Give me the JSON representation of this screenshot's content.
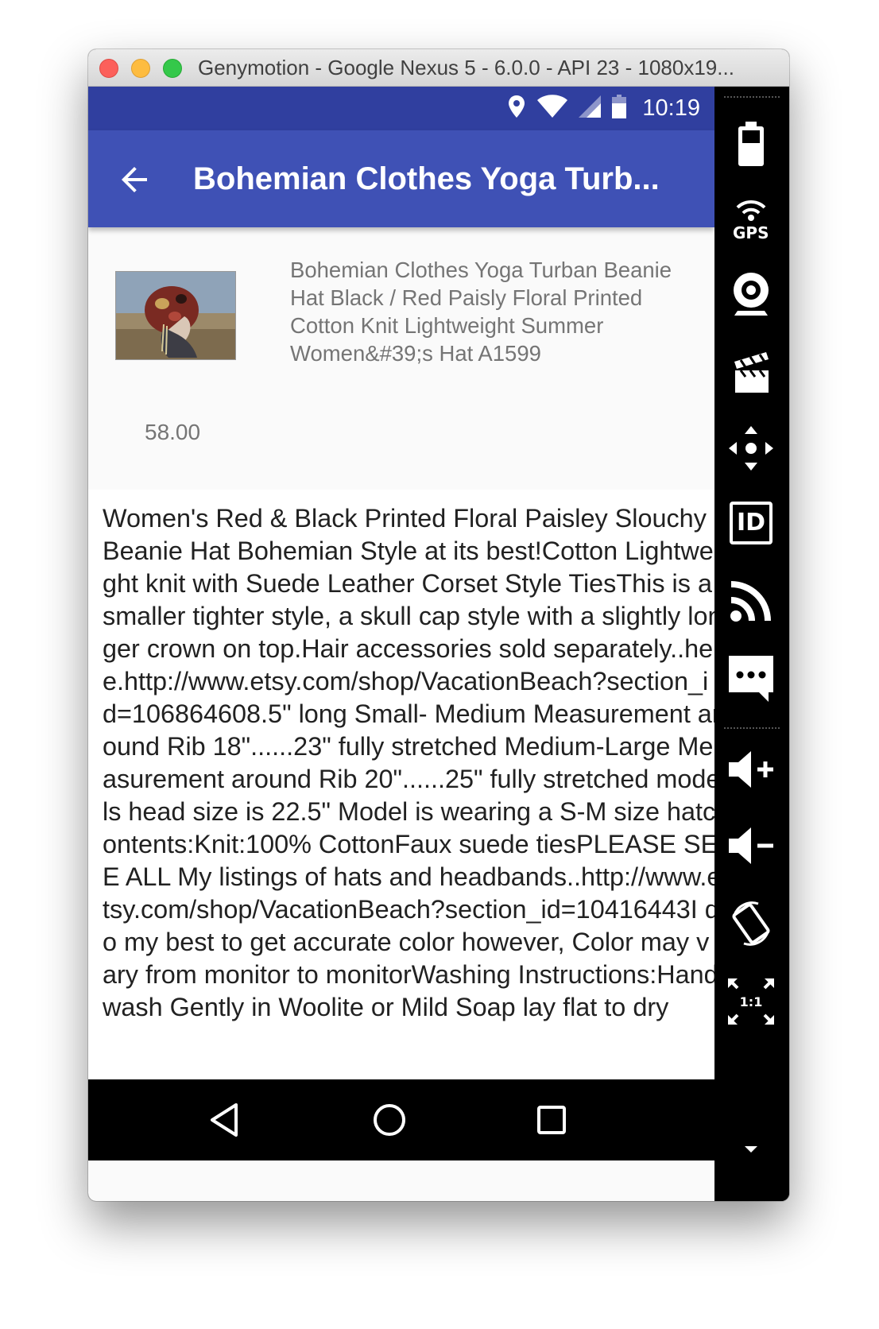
{
  "window": {
    "title": "Genymotion - Google Nexus 5 - 6.0.0 - API 23 - 1080x19..."
  },
  "status_bar": {
    "time": "10:19",
    "icons": [
      "location-icon",
      "wifi-icon",
      "signal-icon",
      "battery-icon"
    ]
  },
  "app_bar": {
    "title": "Bohemian Clothes Yoga Turb...",
    "back_icon": "arrow-back-icon"
  },
  "product": {
    "name": "Bohemian Clothes Yoga Turban Beanie Hat Black / Red Paisly Floral Printed Cotton Knit Lightweight Summer Women&#39;s Hat  A1599",
    "price": "58.00",
    "description": "Women's Red & Black Printed Floral Paisley Slouchy Beanie Hat Bohemian Style at its best!Cotton Lightweight knit with Suede Leather Corset Style TiesThis is a smaller tighter style, a skull cap style with a slightly longer crown on top.Hair accessories sold separately..here.http://www.etsy.com/shop/VacationBeach?section_id=106864608.5\" long Small- Medium Measurement around Rib 18\"......23\" fully stretched Medium-Large Measurement around Rib 20\"......25\" fully stretched models head size is 22.5\" Model is wearing a S-M size hatcontents:Knit:100% CottonFaux suede tiesPLEASE SEE ALL My listings of hats and headbands..http://www.etsy.com/shop/VacationBeach?section_id=10416443I do my best to get accurate color however, Color may vary from monitor to monitorWashing Instructions:Hand wash Gently in Woolite or Mild Soap lay flat to dry"
  },
  "nav_bar": {
    "buttons": [
      "back-triangle-icon",
      "home-circle-icon",
      "recents-square-icon"
    ]
  },
  "sidebar": {
    "gps_label": "GPS",
    "id_label": "ID",
    "pixel_label": "1:1",
    "buttons": [
      "battery-icon",
      "gps-icon",
      "webcam-icon",
      "clapperboard-icon",
      "dpad-icon",
      "id-icon",
      "cast-icon",
      "sms-icon",
      "volume-up-icon",
      "volume-down-icon",
      "rotate-icon",
      "pixel-perfect-icon"
    ]
  },
  "colors": {
    "primary": "#3f51b5",
    "primary_dark": "#303f9f",
    "secondary_text": "#757575"
  }
}
